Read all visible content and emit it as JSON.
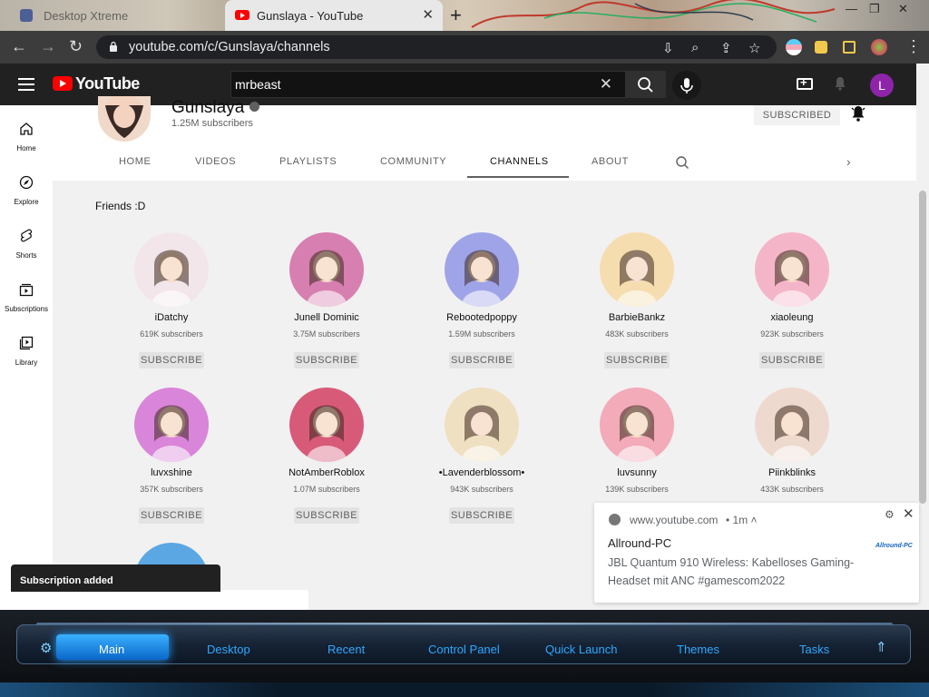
{
  "browser": {
    "inactive_tab": {
      "title": "Desktop Xtreme"
    },
    "active_tab": {
      "title": "Gunslaya - YouTube"
    },
    "url": "youtube.com/c/Gunslaya/channels"
  },
  "youtube": {
    "logo_text": "YouTube",
    "search": {
      "value": "mrbeast"
    },
    "avatar_letter": "L",
    "sidebar": [
      {
        "label": "Home",
        "icon": "home-icon"
      },
      {
        "label": "Explore",
        "icon": "explore-icon"
      },
      {
        "label": "Shorts",
        "icon": "shorts-icon"
      },
      {
        "label": "Subscriptions",
        "icon": "subscriptions-icon"
      },
      {
        "label": "Library",
        "icon": "library-icon"
      }
    ],
    "channel": {
      "name": "Gunslaya",
      "subscribers": "1.25M subscribers",
      "subscribed_label": "SUBSCRIBED"
    },
    "tabs": [
      "HOME",
      "VIDEOS",
      "PLAYLISTS",
      "COMMUNITY",
      "CHANNELS",
      "ABOUT"
    ],
    "active_tab": "CHANNELS",
    "section_title": "Friends :D",
    "subscribe_label": "SUBSCRIBE",
    "channels": [
      {
        "name": "iDatchy",
        "subs": "619K subscribers",
        "color": "#f2e6ea"
      },
      {
        "name": "Junell Dominic",
        "subs": "3.75M subscribers",
        "color": "#d77fb0"
      },
      {
        "name": "Rebootedpoppy",
        "subs": "1.59M subscribers",
        "color": "#9fa4e8"
      },
      {
        "name": "BarbieBankz",
        "subs": "483K subscribers",
        "color": "#f6ddb0"
      },
      {
        "name": "xiaoleung",
        "subs": "923K subscribers",
        "color": "#f5b5c8"
      },
      {
        "name": "luvxshine",
        "subs": "357K subscribers",
        "color": "#d985d9"
      },
      {
        "name": "NotAmberRoblox",
        "subs": "1.07M subscribers",
        "color": "#d85a79"
      },
      {
        "name": "•Lavenderblossom•",
        "subs": "943K subscribers",
        "color": "#efe0c2"
      },
      {
        "name": "luvsunny",
        "subs": "139K subscribers",
        "color": "#f3aab9"
      },
      {
        "name": "Piinkblinks",
        "subs": "433K subscribers",
        "color": "#eed9cf"
      }
    ],
    "toast": "Subscription added"
  },
  "notification": {
    "origin": "www.youtube.com",
    "time": "•  1m ˄",
    "title": "Allround-PC",
    "body": "JBL Quantum 910 Wireless: Kabelloses Gaming-Headset mit ANC #gamescom2022",
    "brand": "Allround-PC"
  },
  "taskbar": {
    "items": [
      "Main",
      "Desktop",
      "Recent",
      "Control Panel",
      "Quick Launch",
      "Themes",
      "Tasks"
    ]
  }
}
